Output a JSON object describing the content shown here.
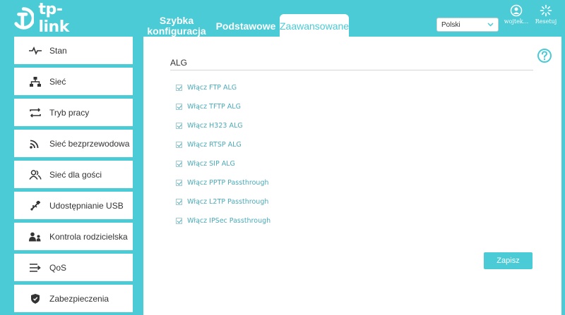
{
  "header": {
    "logo_text": "tp-link",
    "tabs": [
      {
        "label_line1": "Szybka",
        "label_line2": "konfiguracja"
      },
      {
        "label": "Podstawowe"
      },
      {
        "label": "Zaawansowane",
        "active": true
      }
    ],
    "language": {
      "selected": "Polski"
    },
    "user_label": "wojtek...",
    "reset_label": "Resetuj"
  },
  "sidebar": {
    "items": [
      {
        "label": "Stan",
        "icon": "pulse-icon"
      },
      {
        "label": "Sieć",
        "icon": "network-icon"
      },
      {
        "label": "Tryb pracy",
        "icon": "mode-icon"
      },
      {
        "label": "Sieć bezprzewodowa",
        "icon": "wifi-icon"
      },
      {
        "label": "Sieć dla gości",
        "icon": "guests-icon"
      },
      {
        "label": "Udostępnianie USB",
        "icon": "usb-icon"
      },
      {
        "label": "Kontrola rodzicielska",
        "icon": "parental-icon"
      },
      {
        "label": "QoS",
        "icon": "qos-icon"
      },
      {
        "label": "Zabezpieczenia",
        "icon": "shield-icon"
      }
    ]
  },
  "main": {
    "title": "ALG",
    "options": [
      {
        "label": "Włącz FTP ALG",
        "checked": true
      },
      {
        "label": "Włącz TFTP ALG",
        "checked": true
      },
      {
        "label": "Włącz H323 ALG",
        "checked": true
      },
      {
        "label": "Włącz RTSP ALG",
        "checked": true
      },
      {
        "label": "Włącz SIP ALG",
        "checked": true
      },
      {
        "label": "Włącz PPTP Passthrough",
        "checked": true
      },
      {
        "label": "Włącz L2TP Passthrough",
        "checked": true
      },
      {
        "label": "Włącz IPSec Passthrough",
        "checked": true
      }
    ],
    "save_label": "Zapisz"
  },
  "colors": {
    "accent": "#4acbd6",
    "link": "#4aaab8"
  }
}
